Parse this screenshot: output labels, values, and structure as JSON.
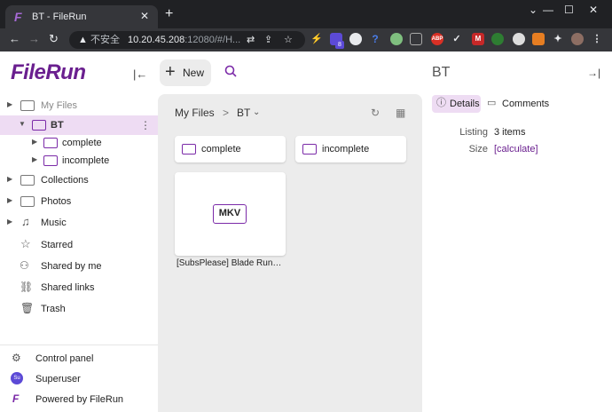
{
  "browser": {
    "tab_title": "BT - FileRun",
    "tab_favicon": "F",
    "tab_close": "✕",
    "new_tab": "+",
    "win_min": "—",
    "win_max": "☐",
    "win_close": "✕",
    "address": {
      "insecure_label": "不安全",
      "host": "10.20.45.208",
      "rest": ":12080/#/H..."
    },
    "extension_badge": "8"
  },
  "app": {
    "logo": "FileRun",
    "sidebar": {
      "tree": [
        {
          "label": "My Files"
        },
        {
          "label": "BT"
        },
        {
          "label": "complete"
        },
        {
          "label": "incomplete"
        },
        {
          "label": "Collections"
        },
        {
          "label": "Photos"
        },
        {
          "label": "Music"
        },
        {
          "label": "Starred"
        },
        {
          "label": "Shared by me"
        },
        {
          "label": "Shared links"
        },
        {
          "label": "Trash"
        }
      ],
      "bottom": [
        {
          "label": "Control panel"
        },
        {
          "label": "Superuser",
          "avatar": "Su"
        },
        {
          "label": "Powered by FileRun"
        }
      ]
    },
    "toolbar": {
      "new_label": "New"
    },
    "breadcrumb": {
      "root": "My Files",
      "sep": ">",
      "current": "BT"
    },
    "folders": [
      {
        "label": "complete"
      },
      {
        "label": "incomplete"
      }
    ],
    "files": [
      {
        "type_badge": "MKV",
        "name": "[SubsPlease] Blade Runn..."
      }
    ],
    "details": {
      "title": "BT",
      "tabs": [
        {
          "label": "Details"
        },
        {
          "label": "Comments"
        }
      ],
      "properties": [
        {
          "key": "Listing",
          "value": "3 items"
        },
        {
          "key": "Size",
          "value": "[calculate]"
        }
      ]
    },
    "colors": {
      "accent": "#7b2aa8",
      "selected_bg": "#eedcf3"
    }
  }
}
